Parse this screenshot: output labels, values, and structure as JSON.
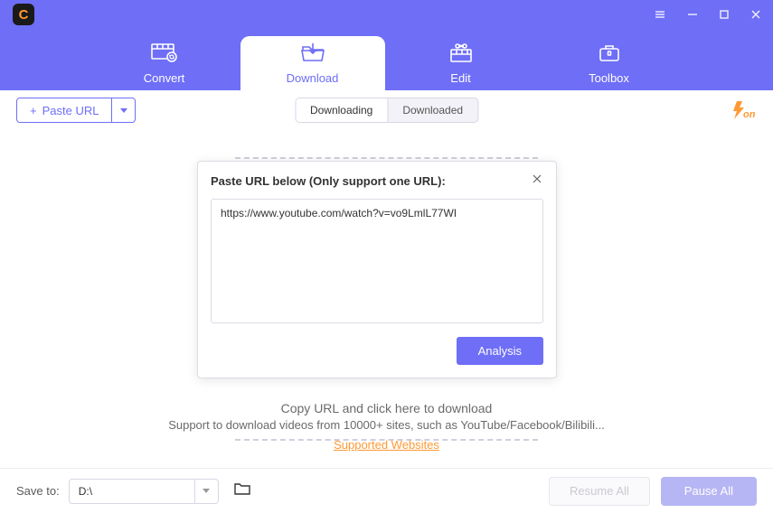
{
  "logo": {
    "letter": "C"
  },
  "tabs": [
    {
      "label": "Convert",
      "icon": "convert-icon"
    },
    {
      "label": "Download",
      "icon": "download-icon"
    },
    {
      "label": "Edit",
      "icon": "edit-icon"
    },
    {
      "label": "Toolbox",
      "icon": "toolbox-icon"
    }
  ],
  "active_tab": 1,
  "toolbar": {
    "paste_url_label": "Paste URL",
    "segments": [
      {
        "label": "Downloading"
      },
      {
        "label": "Downloaded"
      }
    ],
    "active_segment": 0,
    "accel": {
      "text": "on",
      "color_main": "#ff9933"
    }
  },
  "content": {
    "drop_hint": "Copy URL and click here to download",
    "support_text": "Support to download videos from 10000+ sites, such as YouTube/Facebook/Bilibili...",
    "supported_link": "Supported Websites"
  },
  "dialog": {
    "title": "Paste URL below (Only support one URL):",
    "value": "https://www.youtube.com/watch?v=vo9LmlL77WI",
    "analysis_label": "Analysis"
  },
  "footer": {
    "save_to_label": "Save to:",
    "save_path": "D:\\",
    "resume_label": "Resume All",
    "pause_label": "Pause All"
  }
}
